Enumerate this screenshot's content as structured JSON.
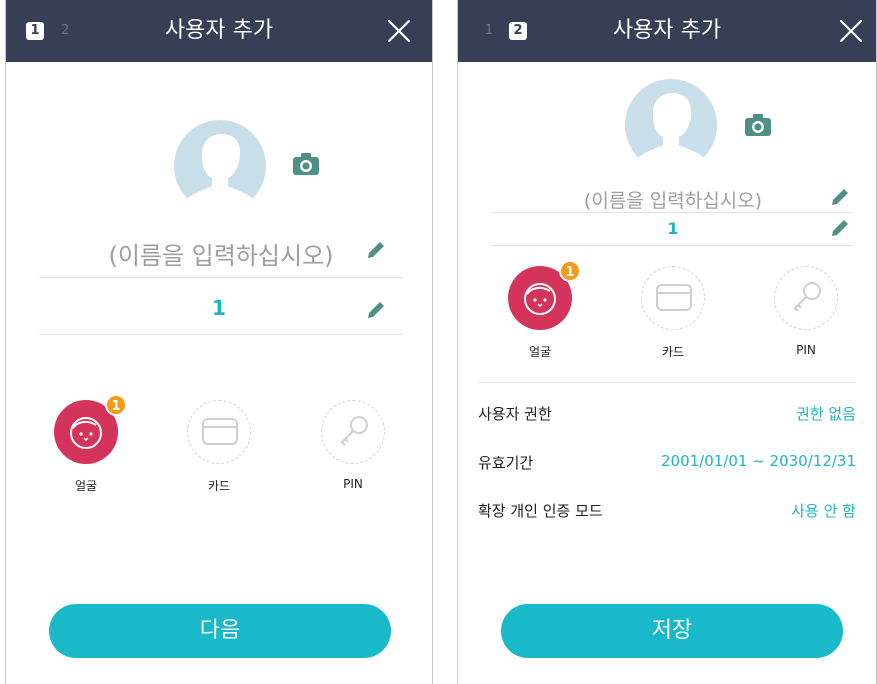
{
  "panel1": {
    "step_active": "1",
    "step_inactive": "2",
    "title": "사용자 추가",
    "name_placeholder": "(이름을 입력하십시오)",
    "user_number": "1",
    "credentials": [
      {
        "label": "얼굴",
        "icon": "face-icon",
        "badge": "1"
      },
      {
        "label": "카드",
        "icon": "card-icon"
      },
      {
        "label": "PIN",
        "icon": "key-icon"
      }
    ],
    "next_button": "다음"
  },
  "panel2": {
    "step_inactive": "1",
    "step_active": "2",
    "title": "사용자 추가",
    "name_placeholder": "(이름을 입력하십시오)",
    "user_number": "1",
    "credentials": [
      {
        "label": "얼굴",
        "icon": "face-icon",
        "badge": "1"
      },
      {
        "label": "카드",
        "icon": "card-icon"
      },
      {
        "label": "PIN",
        "icon": "key-icon"
      }
    ],
    "settings": [
      {
        "label": "사용자 권한",
        "value": "권한 없음"
      },
      {
        "label": "유효기간",
        "value": "2001/01/01 ~ 2030/12/31"
      },
      {
        "label": "확장 개인 인증 모드",
        "value": "사용 안 함"
      }
    ],
    "save_button": "저장"
  },
  "colors": {
    "header": "#363f55",
    "accent": "#19b9c9",
    "face": "#d4335c",
    "badge": "#f39a1b",
    "avatar": "#c8dfe9"
  }
}
